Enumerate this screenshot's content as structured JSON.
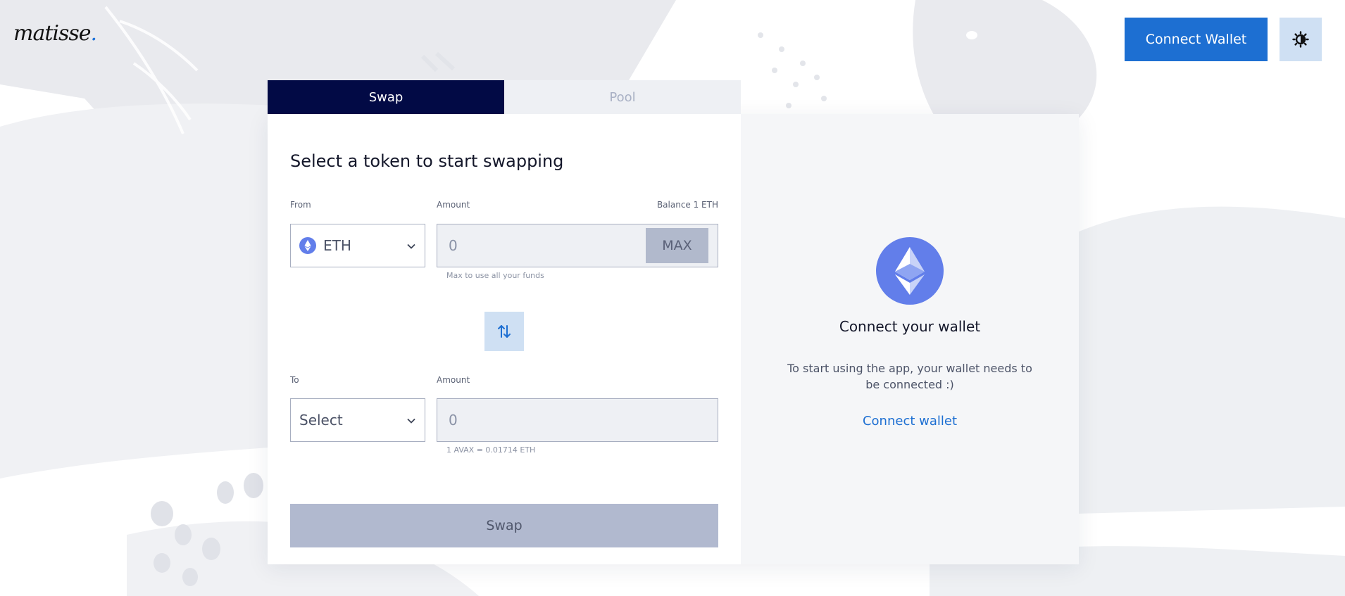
{
  "brand": {
    "logo_text": "matisse",
    "logo_dot": ".",
    "accent_color": "#1d6fd2"
  },
  "header": {
    "connect_wallet_label": "Connect Wallet",
    "theme_icon": "brightness-icon"
  },
  "tabs": [
    {
      "label": "Swap",
      "active": true
    },
    {
      "label": "Pool",
      "active": false
    }
  ],
  "swap": {
    "title": "Select a token to start swapping",
    "from": {
      "label": "From",
      "token": "ETH",
      "token_icon": "ethereum-icon",
      "amount_label": "Amount",
      "balance_label": "Balance 1 ETH",
      "amount_placeholder": "0",
      "max_label": "MAX",
      "hint": "Max to use all your funds"
    },
    "switch_icon": "swap-arrows-icon",
    "to": {
      "label": "To",
      "token_placeholder": "Select",
      "amount_label": "Amount",
      "amount_placeholder": "0",
      "rate": "1 AVAX = 0.01714 ETH"
    },
    "submit_label": "Swap"
  },
  "wallet_panel": {
    "icon": "ethereum-icon",
    "title": "Connect your wallet",
    "text": "To start using the app, your wallet needs to be connected :)",
    "link_label": "Connect wallet"
  }
}
